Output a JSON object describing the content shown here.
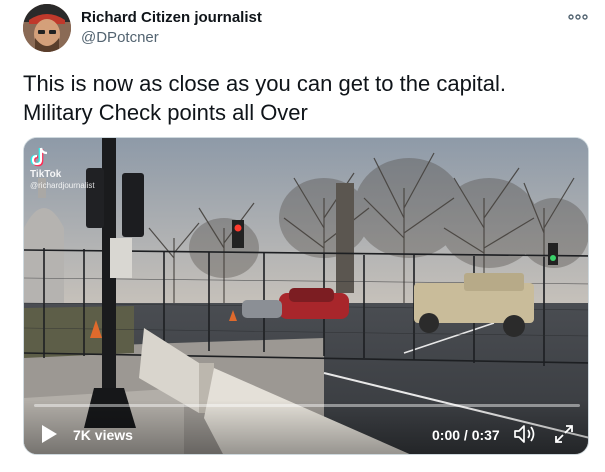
{
  "tweet": {
    "author_name": "Richard Citizen journalist",
    "author_handle": "@DPotcner",
    "text_line1": "This is now  as close as you can get to the capital.",
    "text_line2": "Military Check points all Over"
  },
  "media": {
    "watermark_brand": "TikTok",
    "watermark_user": "@richardjournalist",
    "views": "7K views",
    "time": "0:00 / 0:37",
    "progress": 0.0
  },
  "icons": {
    "more": "more-dots-icon",
    "play": "play-icon",
    "volume": "volume-icon",
    "fullscreen": "fullscreen-icon",
    "tiktok": "tiktok-logo-icon"
  },
  "colors": {
    "text": "#0f1419",
    "secondary": "#536471",
    "border": "#cfd9de"
  }
}
